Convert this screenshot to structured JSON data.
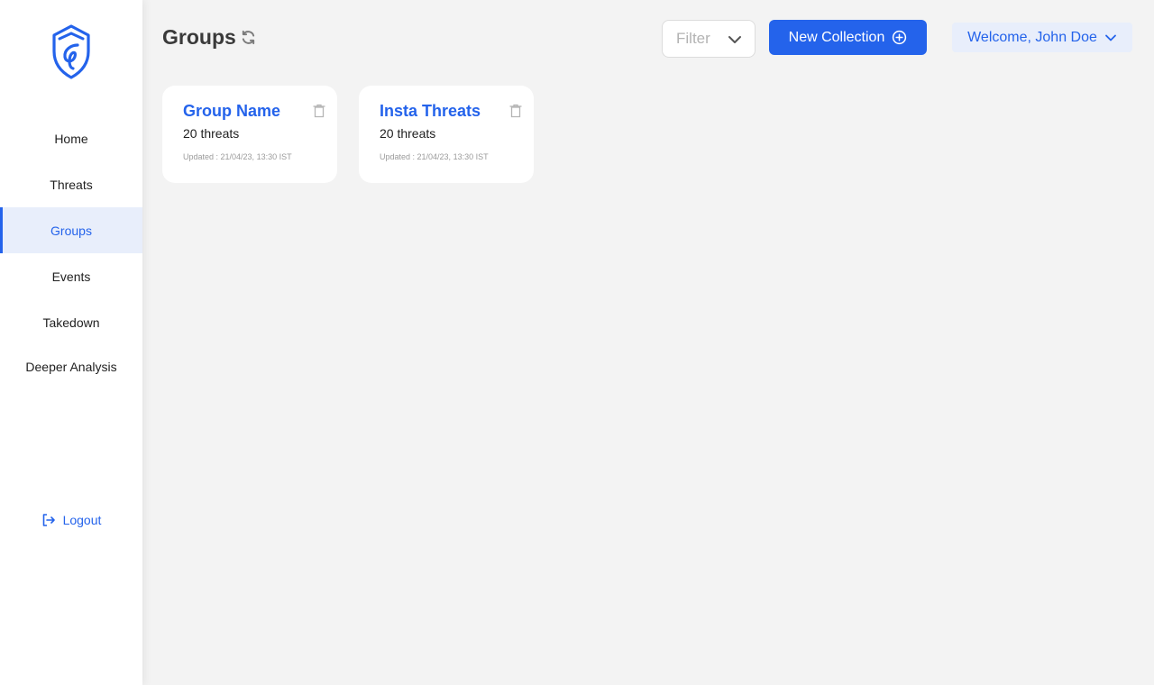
{
  "sidebar": {
    "logo_icon": "shield-logo-icon",
    "items": [
      {
        "label": "Home",
        "active": false
      },
      {
        "label": "Threats",
        "active": false
      },
      {
        "label": "Groups",
        "active": true
      },
      {
        "label": "Events",
        "active": false
      },
      {
        "label": "Takedown",
        "active": false
      },
      {
        "label": "Deeper Analysis",
        "active": false
      }
    ],
    "logout_label": "Logout",
    "logout_icon": "logout-icon"
  },
  "header": {
    "title": "Groups",
    "refresh_icon": "refresh-icon",
    "filter_placeholder": "Filter",
    "new_collection_label": "New Collection",
    "new_collection_icon": "plus-circle-icon",
    "welcome_label": "Welcome, John Doe"
  },
  "groups": [
    {
      "name": "Group Name",
      "count": "20 threats",
      "updated": "Updated : 21/04/23, 13:30 IST"
    },
    {
      "name": "Insta Threats",
      "count": "20 threats",
      "updated": "Updated : 21/04/23, 13:30 IST"
    }
  ],
  "colors": {
    "accent": "#2463eb",
    "active_bg": "#e8eefb",
    "page_bg": "#f3f3f3"
  }
}
